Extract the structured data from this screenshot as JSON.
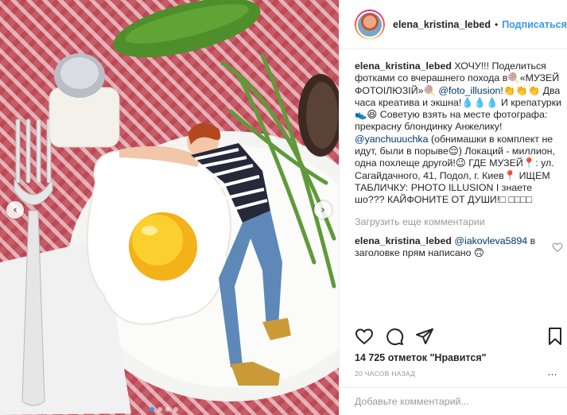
{
  "post": {
    "username": "elena_kristina_lebed",
    "separator": "•",
    "follow_label": "Подписаться"
  },
  "caption": {
    "username": "elena_kristina_lebed",
    "part1": " ХОЧУ!!! Поделиться фотками со вчерашнего похода в🍭«МУЗЕЙ ФОТОІЛЮЗІЙ»🍭 ",
    "mention1": "@foto_illusion!",
    "part2": "👏👏👏 Два часа креатива и экшна!💧💧💧 И крепатурки👟😆 Советую взять на месте фотографа: прекрасну блондинку Анжелику! ",
    "mention2": "@yanchuuuchka",
    "part3": " (обнимашки в комплект не идут, были в порыве😌) Локаций - миллион, одна похлеще другой!😉 ГДЕ МУЗЕЙ📍: ул. Сагайдачного, 41, Подол, г. Киев📍 ИЩЕМ ТАБЛИЧКУ: PHOTO ILLUSION І знаете шо??? КАЙФОНИТЕ ОТ ДУШИ!□ □□□□"
  },
  "load_more_label": "Загрузить еще комментарии",
  "comment": {
    "username": "elena_kristina_lebed",
    "mention": "@iakovleva5894",
    "text": " в заголовке прям написано 🙃"
  },
  "likes_text": "14 725 отметок \"Нравится\"",
  "time_text": "20 ЧАСОВ НАЗАД",
  "add_comment_placeholder": "Добавьте комментарий...",
  "more_label": "…",
  "icons": {
    "like": "heart-icon",
    "comment": "comment-icon",
    "share": "share-icon",
    "save": "bookmark-icon",
    "prev": "chevron-left-icon",
    "next": "chevron-right-icon"
  },
  "carousel_arrows": {
    "prev": "‹",
    "next": "›"
  },
  "carousel": {
    "count": 4,
    "active": 0
  },
  "colors": {
    "link": "#3897f0",
    "mention": "#003569",
    "muted": "#999999",
    "text": "#262626"
  }
}
